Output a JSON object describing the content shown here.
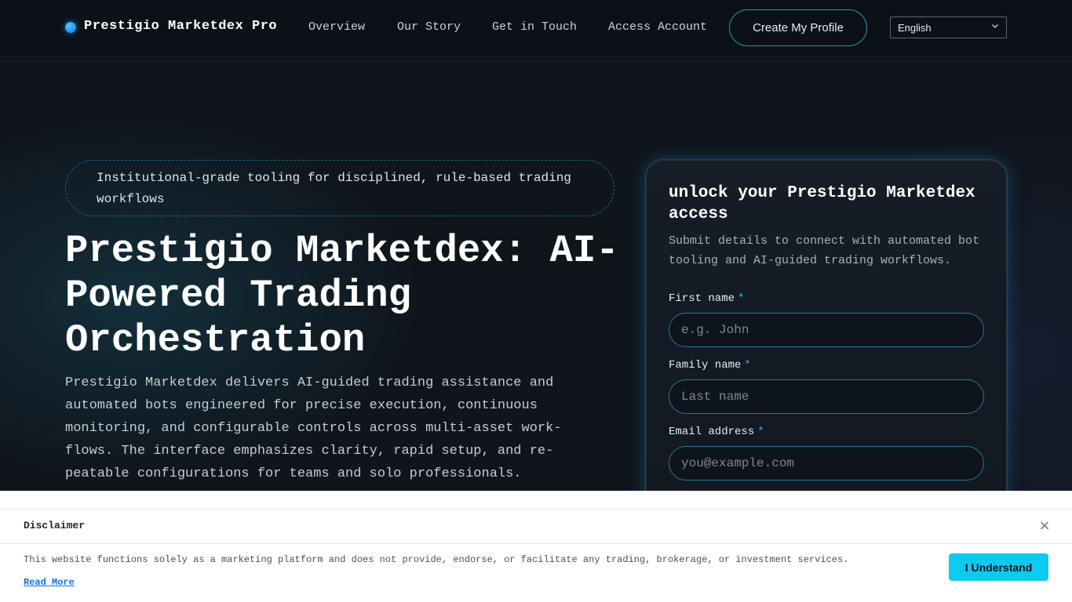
{
  "header": {
    "brand": "Prestigio Marketdex Pro",
    "nav": {
      "overview": "Overview",
      "story": "Our Story",
      "contact": "Get in Touch",
      "login": "Access Account",
      "cta": "Create My Profile"
    },
    "language": "English"
  },
  "hero": {
    "eyebrow": "Institutional-grade tooling for disciplined, rule-based trading workflows",
    "title": "Prestigio Marketdex: AI-Powered Trading Orchestration",
    "description": "Prestigio Marketdex delivers AI-guided trading assistance and automated bots engineered for precise execution, continuous monitoring, and configurable controls across multi-asset work-flows. The interface emphasizes clarity, rapid setup, and re-peatable configurations for teams and solo professionals."
  },
  "form": {
    "title": "unlock your Prestigio Marketdex access",
    "subtitle": "Submit details to connect with automated bot tooling and AI-guided trading workflows.",
    "required_mark": "*",
    "first_name": {
      "label": "First name",
      "placeholder": "e.g. John"
    },
    "family_name": {
      "label": "Family name",
      "placeholder": "Last name"
    },
    "email": {
      "label": "Email address",
      "placeholder": "you@example.com"
    }
  },
  "disclaimer": {
    "title": "Disclaimer",
    "close": "×",
    "text": "This website functions solely as a marketing platform and does not provide, endorse, or facilitate any trading, brokerage, or investment services.",
    "read_more": "Read More",
    "accept": "I Understand"
  },
  "colors": {
    "accent": "#0dcaf0",
    "link": "#0d6efd",
    "outline": "#1f9bc4"
  }
}
